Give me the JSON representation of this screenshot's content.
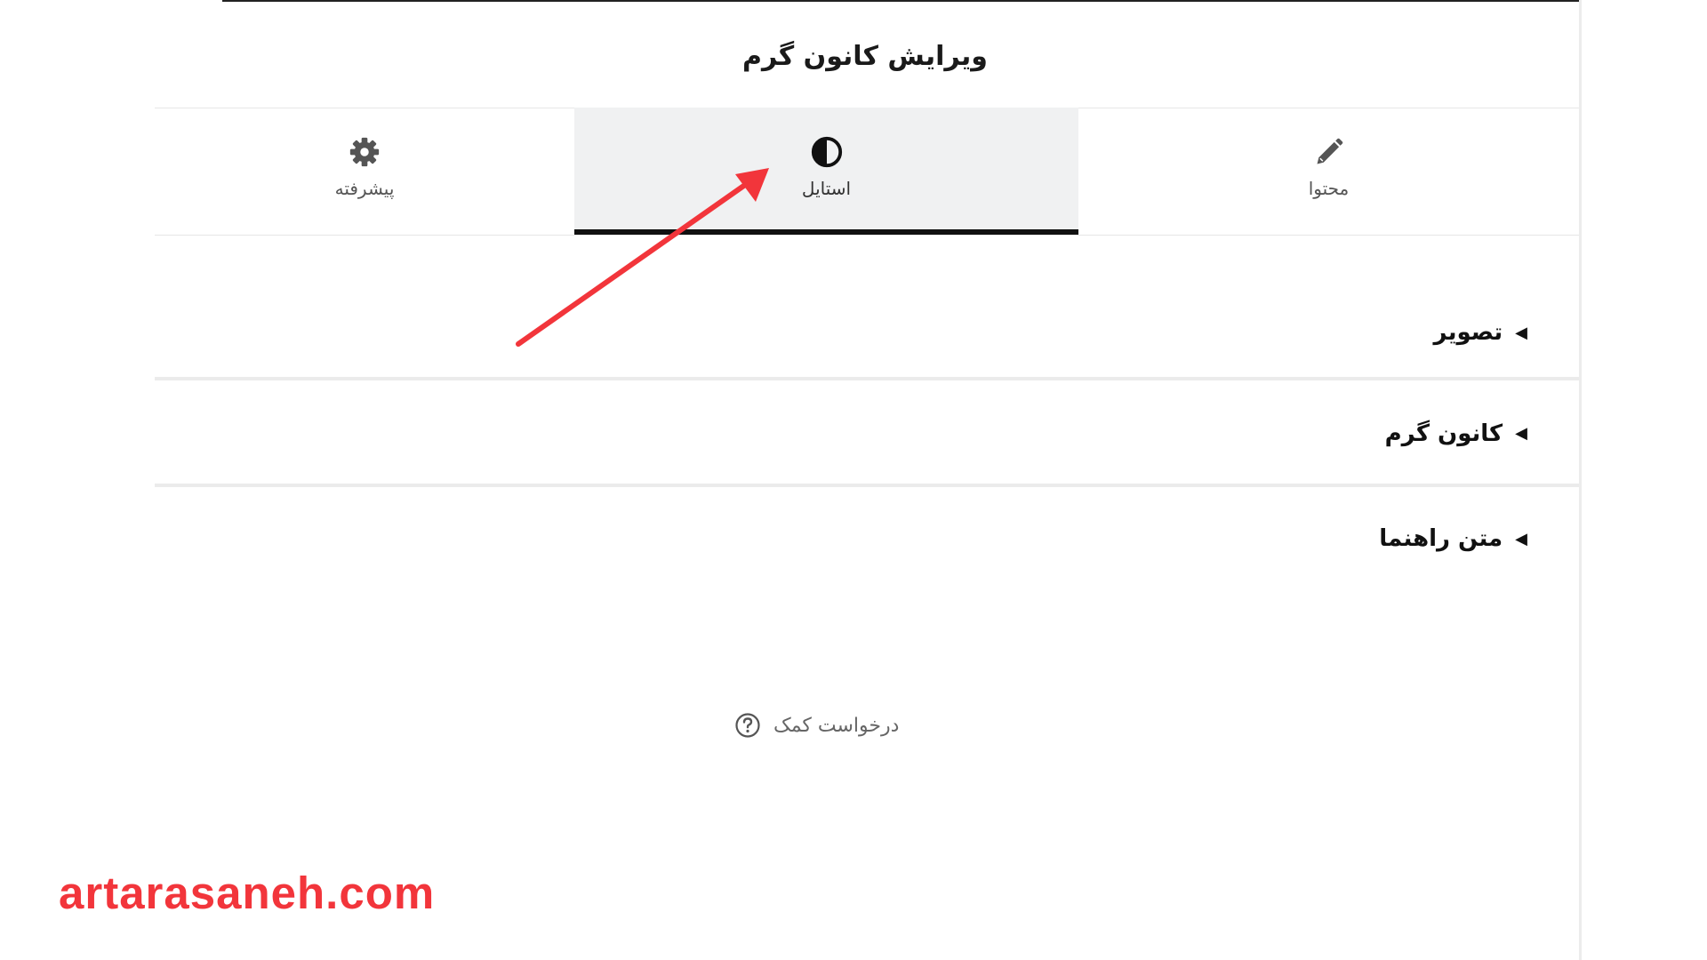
{
  "header": {
    "title": "ویرایش کانون گرم"
  },
  "tabs": [
    {
      "label": "محتوا",
      "icon": "pencil-icon",
      "active": false
    },
    {
      "label": "استایل",
      "icon": "half-circle-contrast-icon",
      "active": true
    },
    {
      "label": "پیشرفته",
      "icon": "gear-icon",
      "active": false
    }
  ],
  "sections": [
    {
      "title": "تصویر",
      "icon": "caret-left-icon"
    },
    {
      "title": "کانون گرم",
      "icon": "caret-left-icon"
    },
    {
      "title": "متن راهنما",
      "icon": "caret-left-icon"
    }
  ],
  "help": {
    "label": "درخواست کمک",
    "icon": "question-circle-icon"
  },
  "watermark": {
    "text": "artarasaneh.com",
    "color": "#f2353b"
  },
  "annotation": {
    "icon": "red-arrow-annotation",
    "color": "#f2353b"
  },
  "colors": {
    "active_tab_bg": "#f0f1f2",
    "active_tab_indicator": "#111111"
  }
}
